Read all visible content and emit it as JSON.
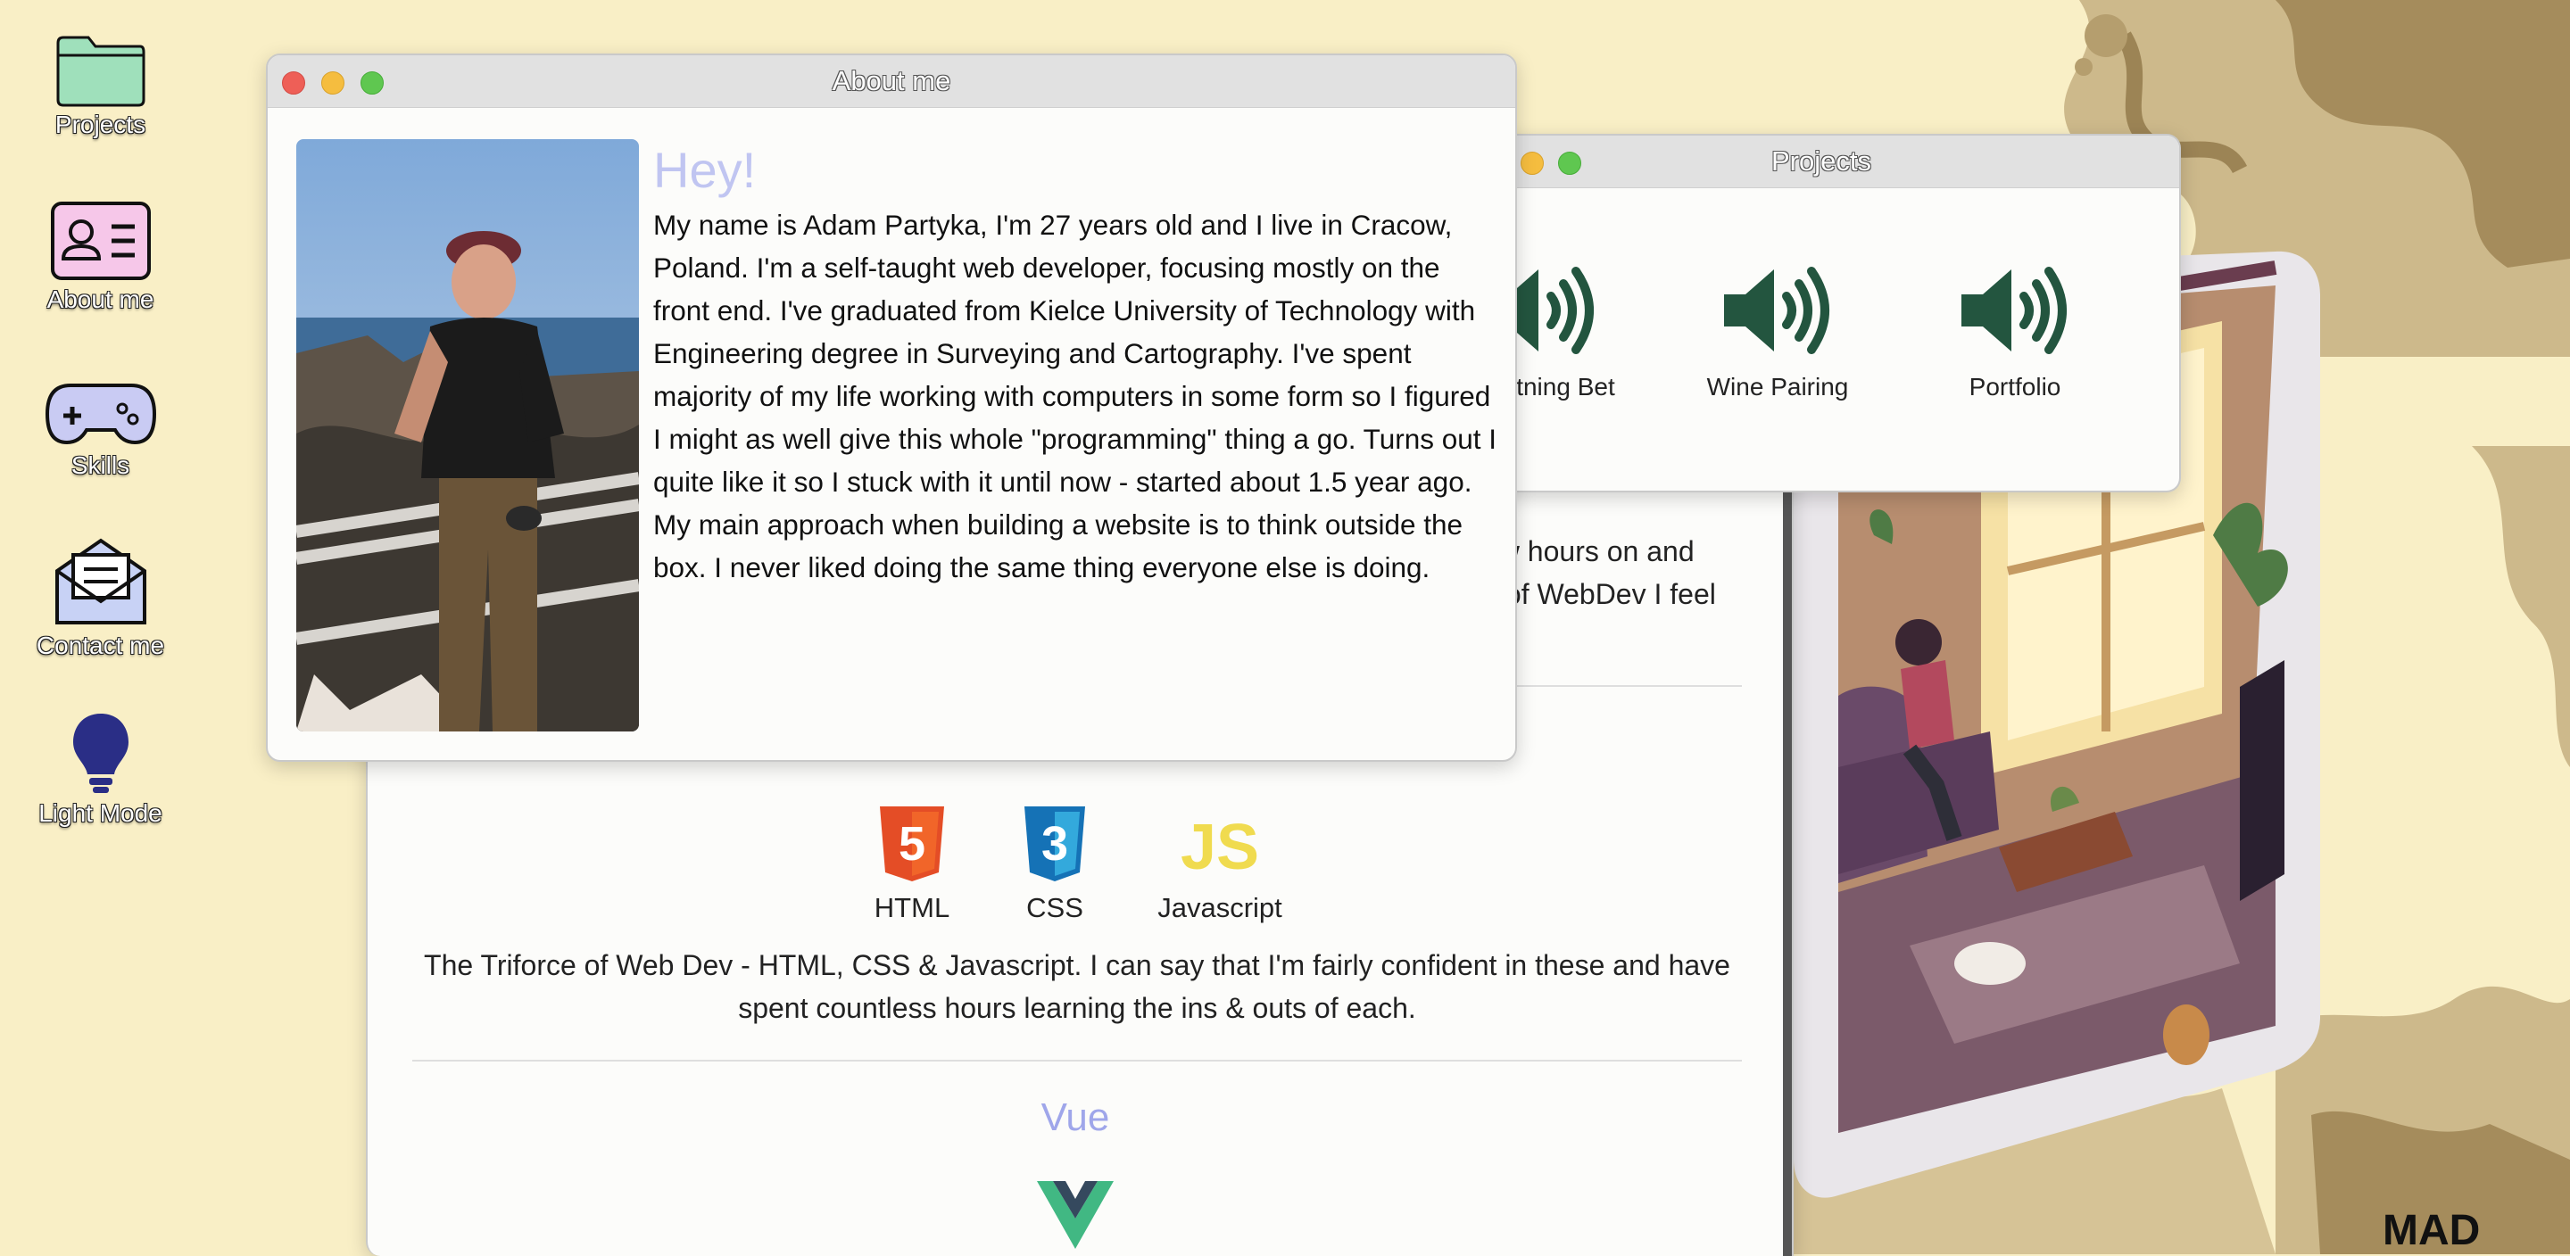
{
  "colors": {
    "desktop_bg": "#f9efc6",
    "accent_lavender": "#c0c5f1",
    "speaker_green": "#23553f"
  },
  "desktop": {
    "icons": [
      {
        "label": "Projects",
        "icon": "folder-icon"
      },
      {
        "label": "About me",
        "icon": "profile-card-icon"
      },
      {
        "label": "Skills",
        "icon": "gamepad-icon"
      },
      {
        "label": "Contact me",
        "icon": "mail-icon"
      },
      {
        "label": "Light Mode",
        "icon": "lightbulb-icon"
      }
    ],
    "signature": "MAD"
  },
  "about_window": {
    "title": "About me",
    "heading": "Hey!",
    "bio": "My name is Adam Partyka, I'm 27 years old and I live in Cracow, Poland. I'm a self-taught web developer, focusing mostly on the front end. I've graduated from Kielce University of Technology with Engineering degree in Surveying and Cartography. I've spent majority of my life working with computers in some form so I figured I might as well give this whole \"programming\" thing a go. Turns out I quite like it so I stuck with it until now - started about 1.5 year ago. My main approach when building a website is to think outside the box. I never liked doing the same thing everyone else is doing."
  },
  "projects_window": {
    "title": "Projects",
    "items": [
      {
        "label": "Lightning Bet",
        "icon": "speaker-icon"
      },
      {
        "label": "Wine Pairing",
        "icon": "speaker-icon"
      },
      {
        "label": "Portfolio",
        "icon": "speaker-icon"
      }
    ]
  },
  "skills_window": {
    "partial_line_1": "ew hours on and",
    "partial_line_2": "s of WebDev I feel",
    "web_skills": [
      {
        "label": "HTML",
        "icon": "html5-icon"
      },
      {
        "label": "CSS",
        "icon": "css3-icon"
      },
      {
        "label": "Javascript",
        "icon": "javascript-icon"
      }
    ],
    "web_description": "The Triforce of Web Dev - HTML, CSS & Javascript. I can say that I'm fairly confident in these and have spent countless hours learning the ins & outs of each.",
    "vue_heading": "Vue",
    "html5_glyph": "5",
    "css3_glyph": "3",
    "js_glyph": "JS"
  }
}
